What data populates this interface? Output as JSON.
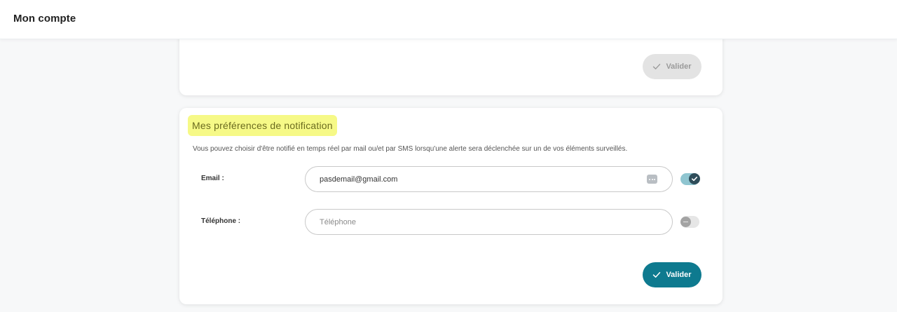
{
  "header": {
    "title": "Mon compte"
  },
  "previous_card": {
    "submit_label": "Valider"
  },
  "notifications": {
    "title": "Mes préférences de notification",
    "description": "Vous pouvez choisir d'être notifié en temps réel par mail ou/et par SMS lorsqu'une alerte sera déclenchée sur un de vos éléments surveillés.",
    "email": {
      "label": "Email :",
      "value": "pasdemail@gmail.com",
      "enabled": true
    },
    "phone": {
      "label": "Téléphone :",
      "placeholder": "Téléphone",
      "value": "",
      "enabled": false
    },
    "submit_label": "Valider"
  },
  "colors": {
    "accent": "#0e7a8f",
    "highlight": "#f6f987",
    "disabled_button": "#e3e3e3"
  },
  "icons": [
    "check-icon",
    "password-manager-icon",
    "toggle-check-icon",
    "toggle-dash-icon"
  ]
}
